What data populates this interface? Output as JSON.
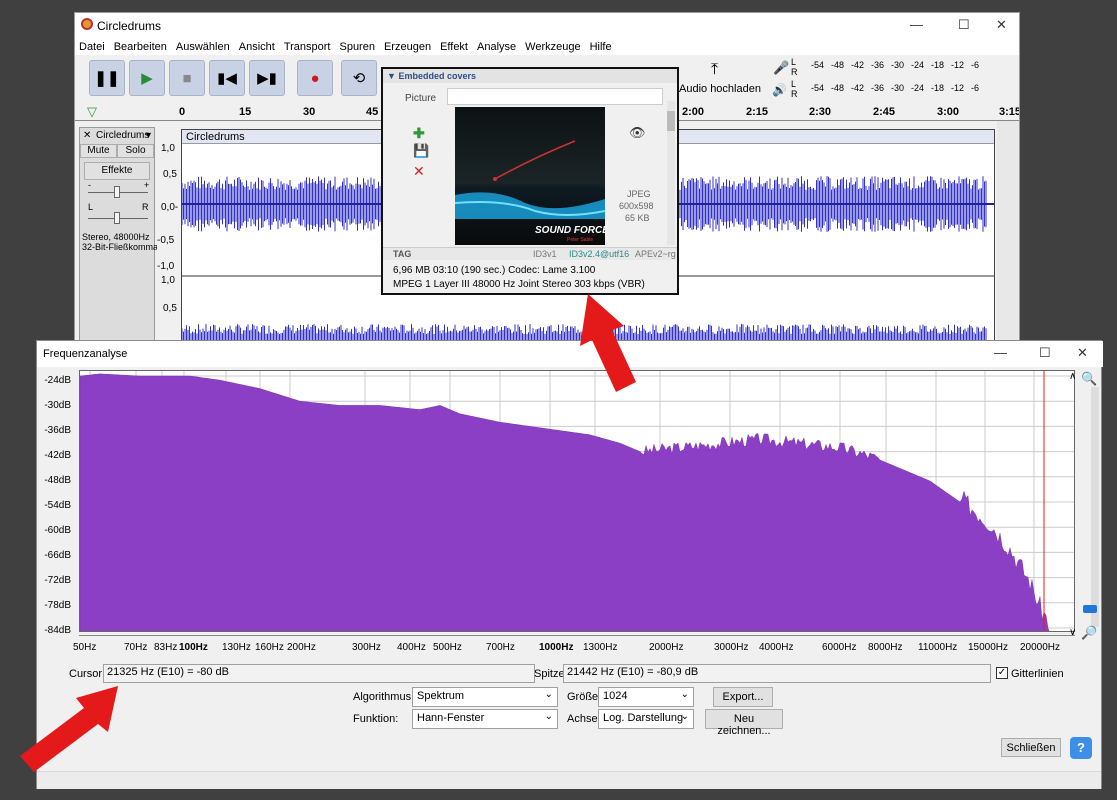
{
  "audacity": {
    "title": "Circledrums",
    "menu": [
      "Datei",
      "Bearbeiten",
      "Auswählen",
      "Ansicht",
      "Transport",
      "Spuren",
      "Erzeugen",
      "Effekt",
      "Analyse",
      "Werkzeuge",
      "Hilfe"
    ],
    "upload_label": "Audio hochladen",
    "meter_ticks": [
      "-54",
      "-48",
      "-42",
      "-36",
      "-30",
      "-24",
      "-18",
      "-12",
      "-6"
    ],
    "meter_L": "L",
    "meter_R": "R",
    "timeline": [
      "0",
      "15",
      "30",
      "45",
      "2:00",
      "2:15",
      "2:30",
      "2:45",
      "3:00",
      "3:15"
    ],
    "track": {
      "name": "Circledrums",
      "clip_name": "Circledrums",
      "mute": "Mute",
      "solo": "Solo",
      "effects": "Effekte",
      "gain_minus": "-",
      "gain_plus": "+",
      "pan_l": "L",
      "pan_r": "R",
      "info1": "Stereo, 48000Hz",
      "info2": "32-Bit-Fließkomma",
      "scale": [
        "1,0",
        "0,5",
        "0,0-",
        "-0,5",
        "-1,0"
      ],
      "scale2": [
        "1,0",
        "0,5"
      ]
    }
  },
  "popup": {
    "section": "Embedded covers",
    "picture_label": "Picture",
    "format": "JPEG",
    "dims": "600x598",
    "size": "65 KB",
    "cover_text": "SOUND FORCE",
    "cover_sub": "Peter Sable",
    "tag_label": "TAG",
    "tag_v1": "ID3v1",
    "tag_v2": "ID3v2.4@utf16",
    "tag_ape": "APEv2~rg",
    "line1": "6,96 MB  03:10 (190 sec.)  Codec: Lame 3.100",
    "line2": "MPEG 1 Layer III  48000 Hz  Joint Stereo  303 kbps (VBR)"
  },
  "freq": {
    "title": "Frequenzanalyse",
    "y_labels": [
      "-24dB",
      "-30dB",
      "-36dB",
      "-42dB",
      "-48dB",
      "-54dB",
      "-60dB",
      "-66dB",
      "-72dB",
      "-78dB",
      "-84dB"
    ],
    "x_labels": [
      "50Hz",
      "70Hz",
      "83Hz",
      "100Hz",
      "130Hz",
      "160Hz",
      "200Hz",
      "300Hz",
      "400Hz",
      "500Hz",
      "700Hz",
      "1000Hz",
      "1300Hz",
      "2000Hz",
      "3000Hz",
      "4000Hz",
      "6000Hz",
      "8000Hz",
      "11000Hz",
      "15000Hz",
      "20000Hz"
    ],
    "cursor_label": "Cursor:",
    "cursor_value": "21325 Hz (E10) = -80 dB",
    "peak_label": "Spitze:",
    "peak_value": "21442 Hz (E10) = -80,9 dB",
    "grid_label": "Gitterlinien",
    "algorithm_label": "Algorithmus:",
    "algorithm_value": "Spektrum",
    "size_label": "Größe:",
    "size_value": "1024",
    "export_label": "Export...",
    "function_label": "Funktion:",
    "function_value": "Hann-Fenster",
    "axis_label": "Achse:",
    "axis_value": "Log. Darstellung",
    "redraw_label": "Neu zeichnen...",
    "close_label": "Schließen",
    "help_label": "?"
  },
  "colors": {
    "spectrum": "#8b3fc4",
    "wave": "#3232c8",
    "arrow": "#e41a1a",
    "cursor_line": "#d22"
  }
}
